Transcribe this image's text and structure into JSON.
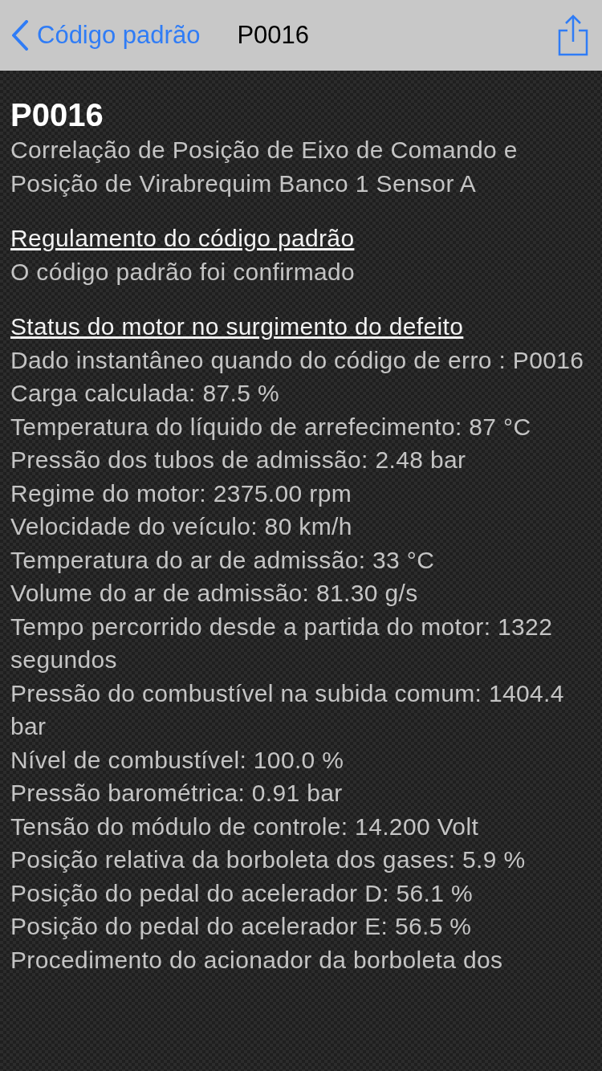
{
  "nav": {
    "back_label": "Código padrão",
    "title": "P0016"
  },
  "code": "P0016",
  "description": "Correlação de Posição de Eixo de Comando e Posição de Virabrequim Banco 1 Sensor A",
  "sections": [
    {
      "heading": "Regulamento do código padrão",
      "lines": [
        "O código padrão foi confirmado"
      ]
    },
    {
      "heading": "Status do motor no surgimento do defeito",
      "lines": [
        "Dado instantâneo quando do código de erro : P0016",
        "Carga calculada: 87.5 %",
        "Temperatura do líquido de arrefecimento: 87 °C",
        "Pressão dos tubos de admissão: 2.48 bar",
        "Regime do motor: 2375.00 rpm",
        "Velocidade do veículo: 80 km/h",
        "Temperatura do ar de admissão: 33 °C",
        "Volume do ar de admissão: 81.30 g/s",
        "Tempo percorrido desde a partida do motor: 1322 segundos",
        "Pressão do combustível na subida comum: 1404.4 bar",
        "Nível de combustível: 100.0 %",
        "Pressão barométrica: 0.91 bar",
        "Tensão do módulo de controle: 14.200 Volt",
        "Posição relativa da borboleta dos gases: 5.9 %",
        "Posição do pedal do acelerador D: 56.1 %",
        "Posição do pedal do acelerador E: 56.5 %",
        "Procedimento do acionador da borboleta dos"
      ]
    }
  ]
}
